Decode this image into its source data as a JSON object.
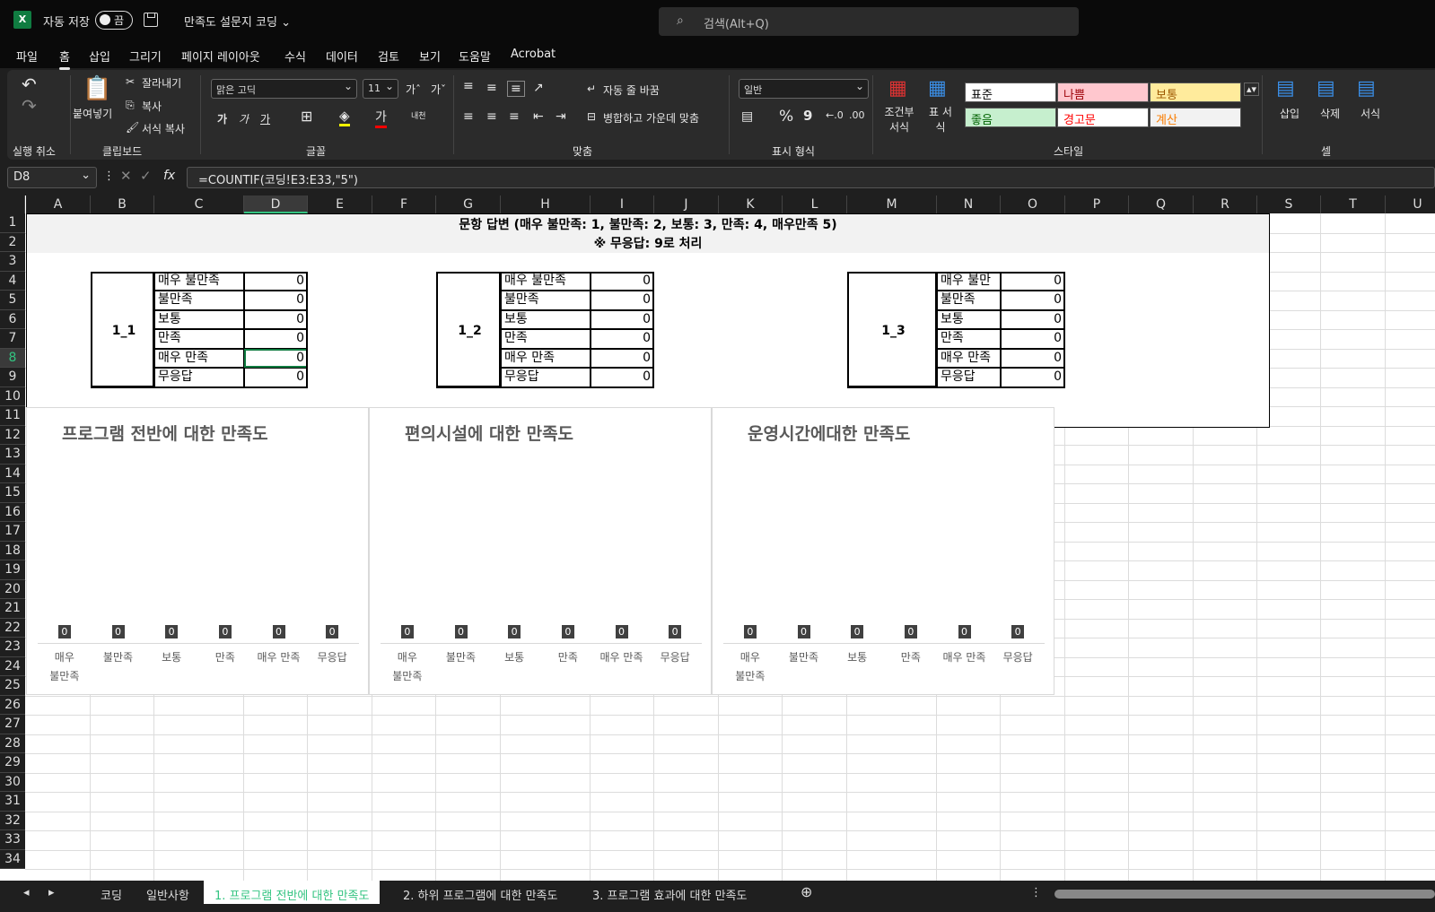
{
  "titlebar": {
    "logo": "X",
    "autosave": "자동 저장",
    "toggle": "끔",
    "doc_title": "만족도 설문지 코딩 ⌄",
    "search_icon": "search-icon",
    "search_placeholder": "검색(Alt+Q)"
  },
  "menu": [
    "파일",
    "홈",
    "삽입",
    "그리기",
    "페이지 레이아웃",
    "수식",
    "데이터",
    "검토",
    "보기",
    "도움말",
    "Acrobat"
  ],
  "ribbon": {
    "undo_group": "실행 취소",
    "clipboard": {
      "paste": "붙여넣기",
      "cut": "잘라내기",
      "copy": "복사",
      "format_painter": "서식 복사",
      "group": "클립보드"
    },
    "font": {
      "name": "맑은 고딕",
      "size": "11",
      "bold": "가",
      "italic": "가",
      "underline": "가",
      "group": "글꼴"
    },
    "align": {
      "wrap": "자동 줄 바꿈",
      "merge": "병합하고 가운데 맞춤",
      "group": "맞춤"
    },
    "number": {
      "format": "일반",
      "percent": "%",
      "comma": "9",
      "group": "표시 형식"
    },
    "cond": "조건부 서식",
    "table": "표 서식",
    "styles": {
      "normal": "표준",
      "bad": "나쁨",
      "neutral": "보통",
      "good": "좋음",
      "warning": "경고문",
      "calc": "계산",
      "group": "스타일"
    },
    "cells": {
      "insert": "삽입",
      "delete": "삭제",
      "format": "서식",
      "group": "셀"
    }
  },
  "formula": {
    "namebox": "D8",
    "fx": "fx",
    "content": "=COUNTIF(코딩!E3:E33,\"5\")"
  },
  "columns": [
    "A",
    "B",
    "C",
    "D",
    "E",
    "F",
    "G",
    "H",
    "I",
    "J",
    "K",
    "L",
    "M",
    "N",
    "O",
    "P",
    "Q",
    "R",
    "S",
    "T",
    "U"
  ],
  "rows": [
    "1",
    "2",
    "3",
    "4",
    "5",
    "6",
    "7",
    "8",
    "9",
    "10",
    "11",
    "12",
    "13",
    "14",
    "15",
    "16",
    "17",
    "18",
    "19",
    "20",
    "21",
    "22",
    "23",
    "24",
    "25",
    "26",
    "27",
    "28",
    "29",
    "30",
    "31",
    "32",
    "33",
    "34"
  ],
  "header": {
    "line1": "문항 답변 (매우 불만족: 1, 불만족: 2, 보통: 3, 만족: 4, 매우만족 5)",
    "line2": "※ 무응답: 9로 처리"
  },
  "tables": [
    {
      "id": "1_1",
      "rows": [
        [
          "매우 불만족",
          "0"
        ],
        [
          "불만족",
          "0"
        ],
        [
          "보통",
          "0"
        ],
        [
          "만족",
          "0"
        ],
        [
          "매우 만족",
          "0"
        ],
        [
          "무응답",
          "0"
        ]
      ]
    },
    {
      "id": "1_2",
      "rows": [
        [
          "매우 불만족",
          "0"
        ],
        [
          "불만족",
          "0"
        ],
        [
          "보통",
          "0"
        ],
        [
          "만족",
          "0"
        ],
        [
          "매우 만족",
          "0"
        ],
        [
          "무응답",
          "0"
        ]
      ]
    },
    {
      "id": "1_3",
      "rows": [
        [
          "매우 불만족",
          "0"
        ],
        [
          "불만족",
          "0"
        ],
        [
          "보통",
          "0"
        ],
        [
          "만족",
          "0"
        ],
        [
          "매우 만족",
          "0"
        ],
        [
          "무응답",
          "0"
        ]
      ]
    }
  ],
  "chart_data": [
    {
      "type": "bar",
      "title": "프로그램 전반에 대한 만족도",
      "categories": [
        "매우\n불만족",
        "불만족",
        "보통",
        "만족",
        "매우 만족",
        "무응답"
      ],
      "values": [
        0,
        0,
        0,
        0,
        0,
        0
      ]
    },
    {
      "type": "bar",
      "title": "편의시설에 대한 만족도",
      "categories": [
        "매우\n불만족",
        "불만족",
        "보통",
        "만족",
        "매우 만족",
        "무응답"
      ],
      "values": [
        0,
        0,
        0,
        0,
        0,
        0
      ]
    },
    {
      "type": "bar",
      "title": "운영시간에대한 만족도",
      "categories": [
        "매우\n불만족",
        "불만족",
        "보통",
        "만족",
        "매우 만족",
        "무응답"
      ],
      "values": [
        0,
        0,
        0,
        0,
        0,
        0
      ]
    }
  ],
  "sheet_tabs": [
    "코딩",
    "일반사항",
    "1. 프로그램 전반에 대한 만족도",
    "2. 하위 프로그램에 대한 만족도",
    "3. 프로그램 효과에 대한 만족도"
  ],
  "colors": {
    "excel_green": "#107c41",
    "active_tab": "#33c481",
    "bad_bg": "#ffc7ce",
    "bad_fg": "#9c0006",
    "neutral_bg": "#ffeb9c",
    "neutral_fg": "#9c5700",
    "good_bg": "#c6efce",
    "good_fg": "#006100",
    "calc_fg": "#fa7d00"
  }
}
